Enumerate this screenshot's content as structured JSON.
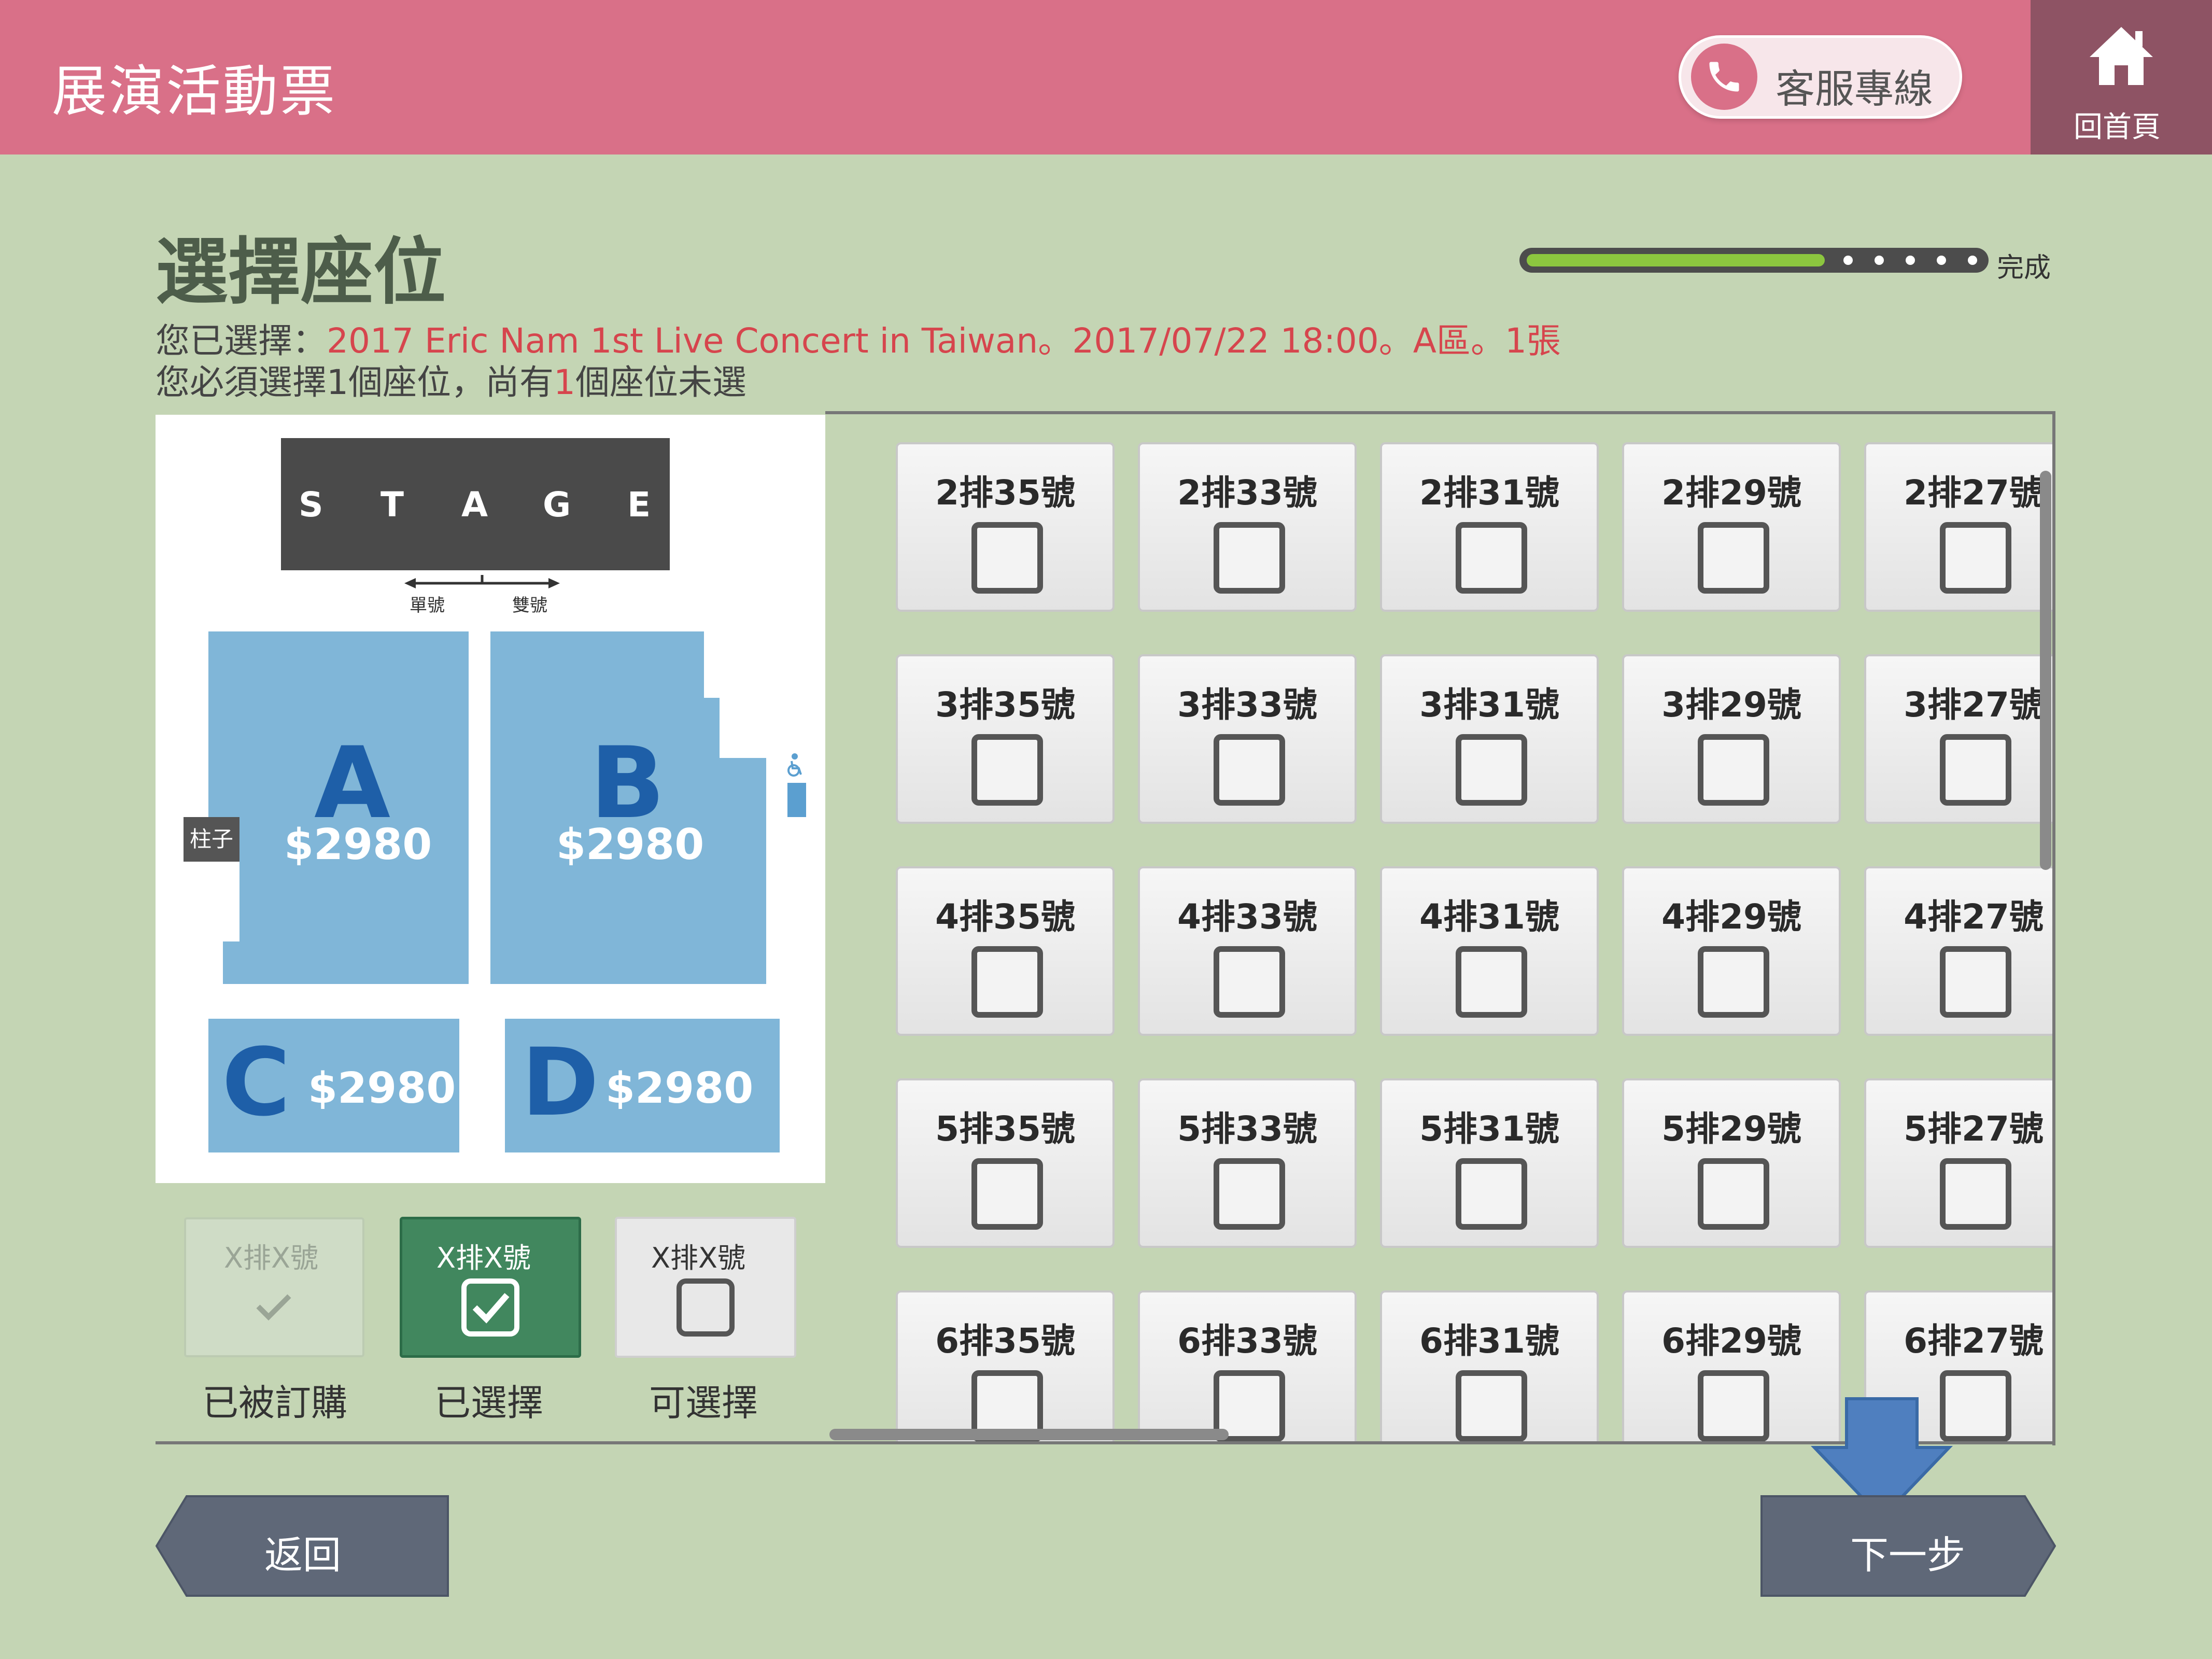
{
  "header": {
    "app_title": "展演活動票",
    "hotline_label": "客服專線",
    "home_label": "回首頁"
  },
  "page": {
    "title": "選擇座位",
    "progress": {
      "label": "完成",
      "fraction": 0.65
    },
    "info": {
      "prefix": "您已選擇：",
      "selection": "2017 Eric Nam 1st Live Concert in Taiwan。2017/07/22 18:00。A區。1張",
      "req_prefix": "您必須選擇1個座位，尚有",
      "remaining": "1",
      "req_suffix": "個座位未選"
    }
  },
  "venue_map": {
    "stage_letters": [
      "S",
      "T",
      "A",
      "G",
      "E"
    ],
    "odd_label": "單號",
    "even_label": "雙號",
    "pillar_label": "柱子",
    "sections": [
      {
        "name": "A",
        "price": "$2980"
      },
      {
        "name": "B",
        "price": "$2980"
      },
      {
        "name": "C",
        "price": "$2980"
      },
      {
        "name": "D",
        "price": "$2980"
      }
    ]
  },
  "legend": [
    {
      "seat_text": "X排X號",
      "caption": "已被訂購",
      "state": "booked"
    },
    {
      "seat_text": "X排X號",
      "caption": "已選擇",
      "state": "selected"
    },
    {
      "seat_text": "X排X號",
      "caption": "可選擇",
      "state": "available"
    }
  ],
  "seats": [
    [
      "2排35號",
      "2排33號",
      "2排31號",
      "2排29號",
      "2排27號"
    ],
    [
      "3排35號",
      "3排33號",
      "3排31號",
      "3排29號",
      "3排27號"
    ],
    [
      "4排35號",
      "4排33號",
      "4排31號",
      "4排29號",
      "4排27號"
    ],
    [
      "5排35號",
      "5排33號",
      "5排31號",
      "5排29號",
      "5排27號"
    ],
    [
      "6排35號",
      "6排33號",
      "6排31號",
      "6排29號",
      "6排27號"
    ]
  ],
  "buttons": {
    "back": "返回",
    "next": "下一步"
  },
  "colors": {
    "header": "#d97088",
    "home": "#8e5364",
    "background": "#c4d5b4",
    "highlight": "#d6454d",
    "section_fill": "#80b6d8",
    "section_letter": "#1e5fa8",
    "selected": "#41875e",
    "progress": "#8cc63f",
    "nav_button": "#5f6878",
    "arrow": "#4f7fbf"
  }
}
